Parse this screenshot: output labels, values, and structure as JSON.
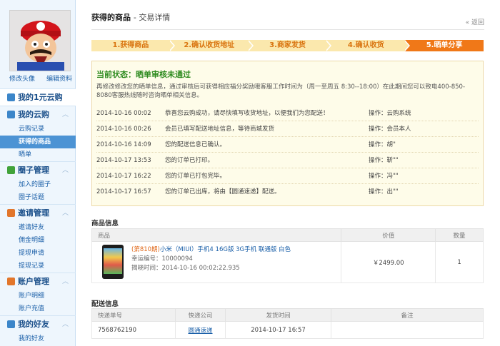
{
  "sidebar": {
    "avatar_links": [
      "修改头像",
      "编辑资料"
    ],
    "home": "我的1元云购",
    "groups": [
      {
        "title": "我的云购",
        "items": [
          "云购记录",
          "获得的商品",
          "晒单"
        ]
      },
      {
        "title": "圈子管理",
        "items": [
          "加入的圈子",
          "圈子话题"
        ]
      },
      {
        "title": "邀请管理",
        "items": [
          "邀请好友",
          "佣金明细",
          "提现申请",
          "提现记录"
        ]
      },
      {
        "title": "账户管理",
        "items": [
          "账户明细",
          "账户充值"
        ]
      },
      {
        "title": "我的好友",
        "items": [
          "我的好友"
        ]
      }
    ],
    "icon_colors": [
      "#3c86c9",
      "#3c86c9",
      "#41a33a",
      "#e2762b",
      "#e2762b",
      "#3c86c9"
    ]
  },
  "page": {
    "title": "获得的商品",
    "subtitle": "交易详情",
    "back": "返回"
  },
  "steps": [
    "1.获得商品",
    "2.确认收货地址",
    "3.商家发货",
    "4.确认收货",
    "5.晒单分享"
  ],
  "status": {
    "title": "当前状态：晒单审核未通过",
    "desc": "再修改修改您的晒单信息，通过审核后可获得相应福分奖励哦客服工作时间为（周一至周五 8:30--18:00）在此期间您可以致电400-850-8080客服热线随时咨询晒单相关信息。",
    "log": [
      {
        "time": "2014-10-16 00:02",
        "msg": "恭喜您云购成功，请尽快填写收货地址，以便我们为您配送！",
        "op": "操作：云购系统"
      },
      {
        "time": "2014-10-16 00:26",
        "msg": "会员已填写配送地址信息，等待商城发货",
        "op": "操作：会员本人"
      },
      {
        "time": "2014-10-16 14:09",
        "msg": "您的配送信息已确认。",
        "op": "操作：胡\""
      },
      {
        "time": "2014-10-17 13:53",
        "msg": "您的订单已打印。",
        "op": "操作：靳\"\""
      },
      {
        "time": "2014-10-17 16:22",
        "msg": "您的订单已打包完毕。",
        "op": "操作：冯\"\""
      },
      {
        "time": "2014-10-17 16:57",
        "msg": "您的订单已出库，将由【圆通速递】配送。",
        "op": "操作：出\"\""
      }
    ]
  },
  "product": {
    "section": "商品信息",
    "headers": [
      "商品",
      "价值",
      "数量"
    ],
    "tag": "(第810期)",
    "name": "小米（MIUI）手机4 16G版 3G手机 联通版 白色",
    "lucky": "幸运编号：10000094",
    "time": "揭晓时间：2014-10-16 00:02:22.935",
    "price": "￥2499.00",
    "qty": "1"
  },
  "delivery": {
    "section": "配送信息",
    "headers": [
      "快递单号",
      "快递公司",
      "发货时间",
      "备注"
    ],
    "no": "7568762190",
    "company": "圆通速递",
    "time": "2014-10-17 16:57",
    "note": ""
  }
}
